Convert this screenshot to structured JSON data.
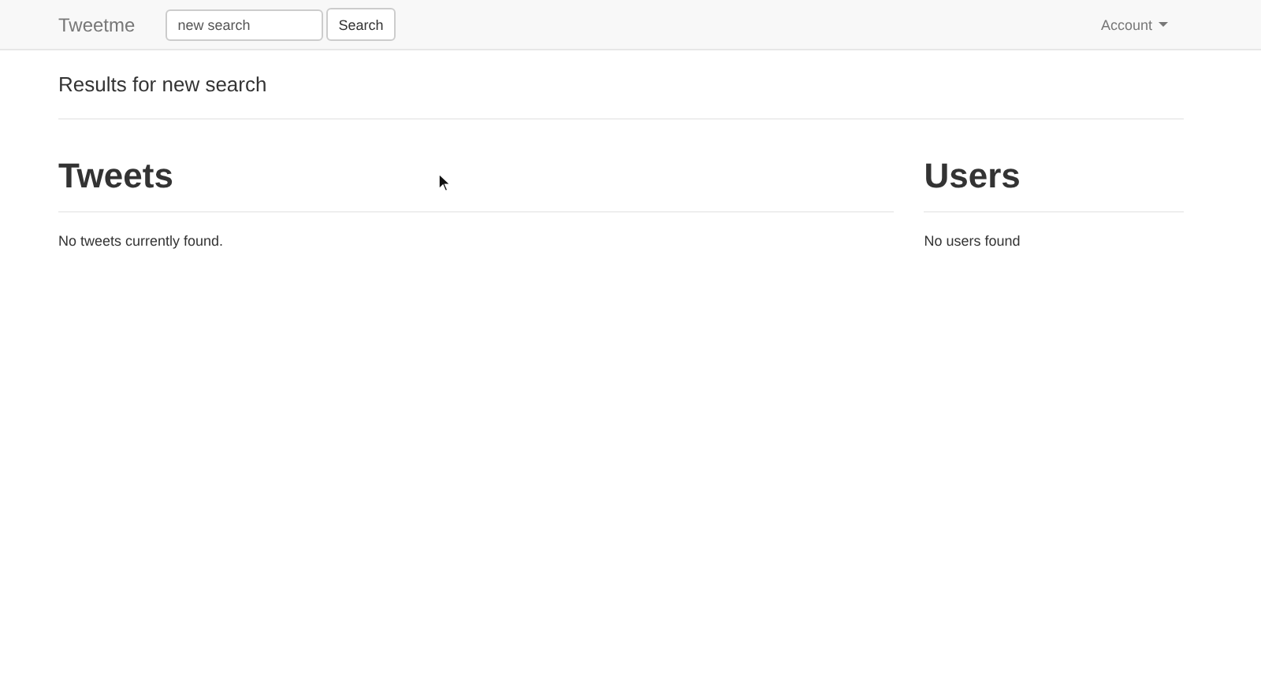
{
  "navbar": {
    "brand": "Tweetme",
    "search": {
      "value": "new search"
    },
    "search_button": "Search",
    "account_menu": "Account"
  },
  "heading": "Results for new search",
  "sections": [
    {
      "title": "Tweets",
      "message": "No tweets currently found."
    },
    {
      "title": "Users",
      "message": "No users found"
    }
  ]
}
